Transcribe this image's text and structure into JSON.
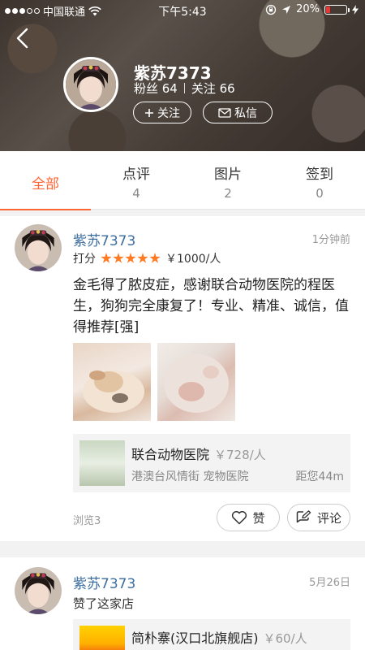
{
  "status_bar": {
    "carrier": "中国联通",
    "time": "下午5:43",
    "battery": "20%",
    "battery_level": 0.2
  },
  "profile": {
    "username": "紫苏7373",
    "fans_label": "粉丝 64",
    "follow_label": "关注 66",
    "follow_button": "关注",
    "message_button": "私信"
  },
  "tabs": [
    {
      "label": "全部",
      "count": ""
    },
    {
      "label": "点评",
      "count": "4"
    },
    {
      "label": "图片",
      "count": "2"
    },
    {
      "label": "签到",
      "count": "0"
    }
  ],
  "feed": [
    {
      "author": "紫苏7373",
      "time": "1分钟前",
      "rating_label": "打分",
      "stars": 5,
      "price": "￥1000/人",
      "text": "金毛得了脓皮症，感谢联合动物医院的程医生，狗狗完全康复了！专业、精准、诚信，值得推荐[强]",
      "shop": {
        "name": "联合动物医院",
        "price": "￥728/人",
        "location": "港澳台风情街 宠物医院",
        "distance": "距您44m"
      },
      "views": "浏览3",
      "like_label": "赞",
      "comment_label": "评论"
    },
    {
      "author": "紫苏7373",
      "time": "5月26日",
      "subtitle": "赞了这家店",
      "shop": {
        "name": "简朴寨(汉口北旗舰店)",
        "price": "￥60/人"
      }
    }
  ],
  "colors": {
    "accent": "#ff6633",
    "name_blue": "#3d6ea0",
    "star": "#ff7a22"
  }
}
